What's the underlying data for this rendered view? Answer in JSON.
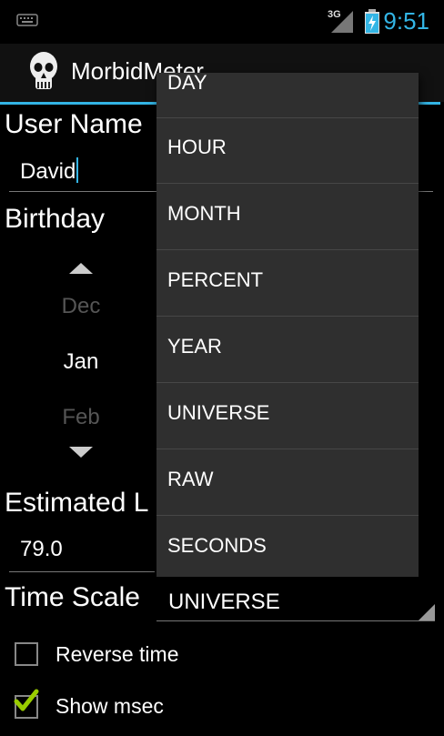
{
  "status_bar": {
    "network": "3G",
    "time": "9:51",
    "accent_color": "#33b5e5",
    "keyboard_icon": "keyboard-icon",
    "signal_icon": "signal-icon",
    "battery_icon": "battery-charging-icon"
  },
  "action_bar": {
    "title": "MorbidMeter",
    "icon": "skull-icon"
  },
  "form": {
    "user_name_label": "User Name",
    "user_name_value": "David",
    "birthday_label": "Birthday",
    "months": [
      "Dec",
      "Jan",
      "Feb"
    ],
    "estimated_label": "Estimated L",
    "estimated_value": "79.0",
    "time_scale_label": "Time Scale",
    "time_scale_value": "UNIVERSE",
    "reverse_time_label": "Reverse time",
    "reverse_time_checked": false,
    "show_msec_label": "Show msec",
    "show_msec_checked": true
  },
  "dropdown": {
    "items": [
      "DAY",
      "HOUR",
      "MONTH",
      "PERCENT",
      "YEAR",
      "UNIVERSE",
      "RAW",
      "SECONDS"
    ]
  }
}
